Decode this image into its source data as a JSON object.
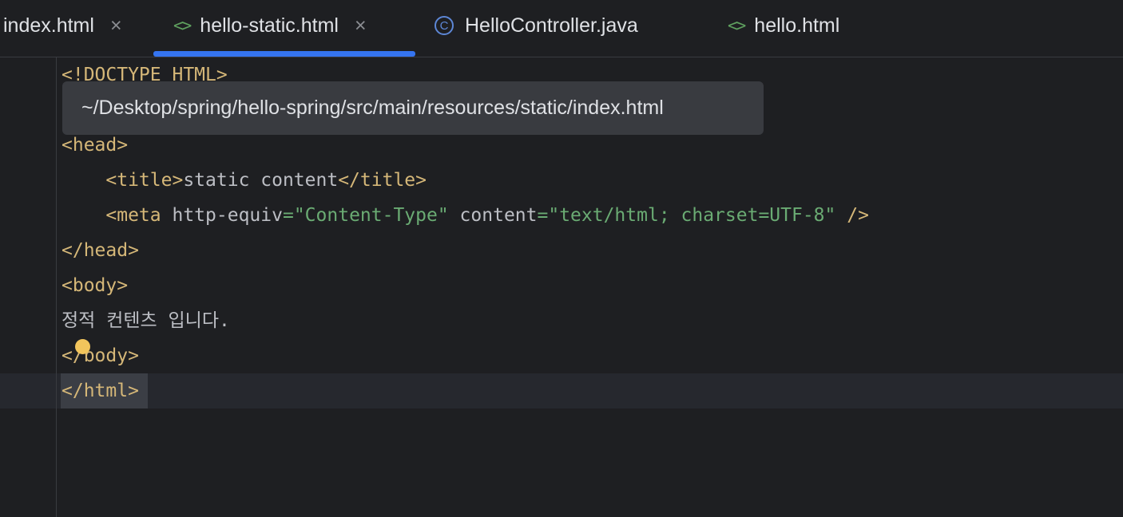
{
  "tabs": [
    {
      "label": "index.html",
      "close": "×"
    },
    {
      "label": "hello-static.html",
      "icon": "<>",
      "close": "×",
      "active": true
    },
    {
      "label": "HelloController.java",
      "icon": "C"
    },
    {
      "label": "hello.html",
      "icon": "<>"
    }
  ],
  "tooltip": {
    "path": "~/Desktop/spring/hello-spring/src/main/resources/static/index.html"
  },
  "code": {
    "doctype": "<!DOCTYPE HTML>",
    "head_open": "<head>",
    "title_open": "<title>",
    "title_text": "static content",
    "title_close": "</title>",
    "meta_open": "<meta",
    "meta_attr1": " http-equiv",
    "meta_eq1": "=",
    "meta_val1": "\"Content-Type\"",
    "meta_attr2": " content",
    "meta_eq2": "=",
    "meta_val2": "\"text/html; charset=UTF-8\"",
    "meta_close": " />",
    "head_close": "</head>",
    "body_open": "<body>",
    "body_text": "정적 컨텐츠 입니다.",
    "body_close": "</body>",
    "html_close": "</html>"
  },
  "colors": {
    "tag": "#d5b778",
    "string": "#6aab73",
    "text": "#bcbec4",
    "accent": "#3574f0",
    "background": "#1e1f22"
  }
}
